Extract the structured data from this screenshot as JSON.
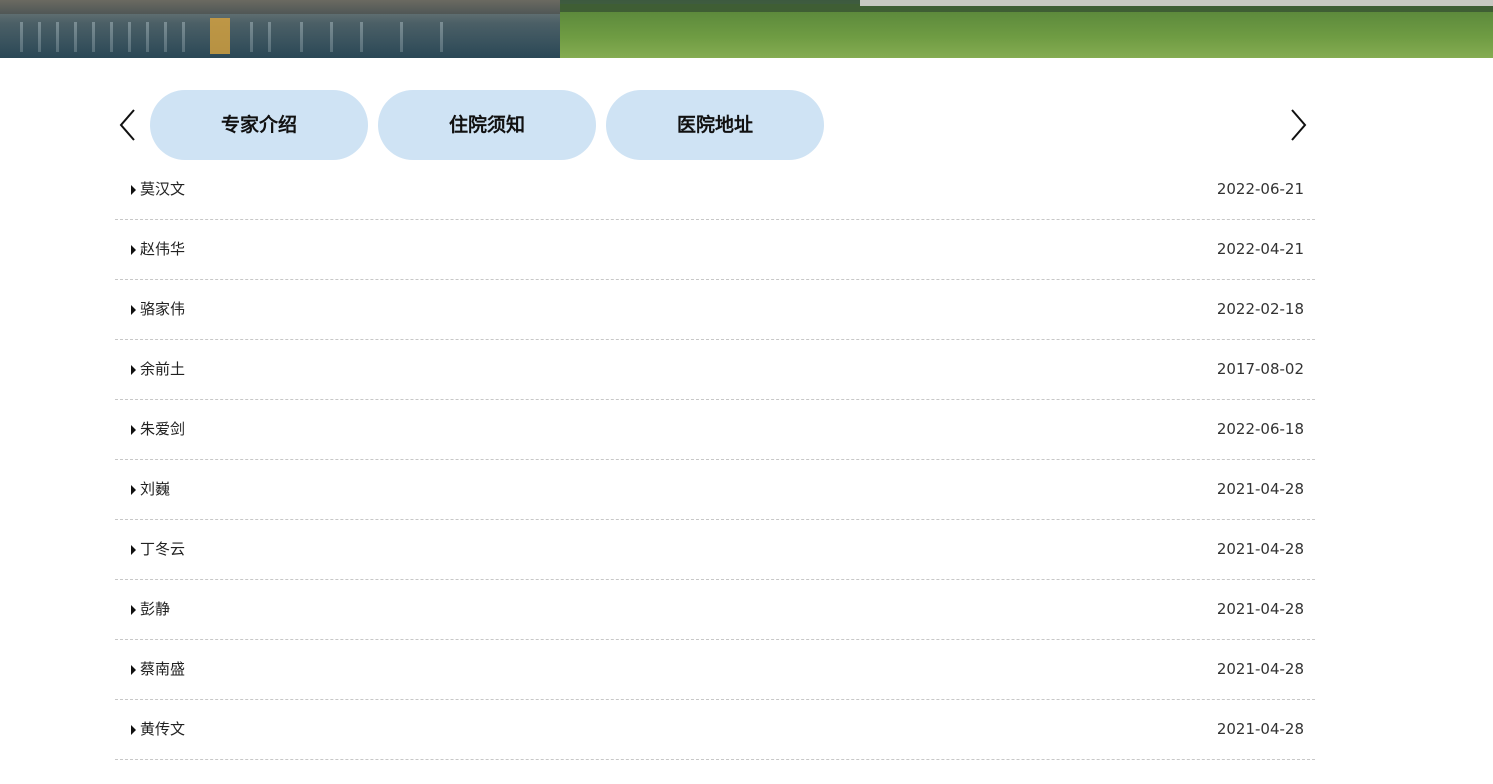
{
  "banner": {
    "alt": "hospital building exterior"
  },
  "tabs": {
    "prev_icon": "chevron-left-icon",
    "next_icon": "chevron-right-icon",
    "items": [
      {
        "label": "专家介绍"
      },
      {
        "label": "住院须知"
      },
      {
        "label": "医院地址"
      }
    ]
  },
  "list": {
    "items": [
      {
        "name": "莫汉文",
        "date": "2022-06-21"
      },
      {
        "name": "赵伟华",
        "date": "2022-04-21"
      },
      {
        "name": "骆家伟",
        "date": "2022-02-18"
      },
      {
        "name": "余前土",
        "date": "2017-08-02"
      },
      {
        "name": "朱爱剑",
        "date": "2022-06-18"
      },
      {
        "name": "刘巍",
        "date": "2021-04-28"
      },
      {
        "name": "丁冬云",
        "date": "2021-04-28"
      },
      {
        "name": "彭静",
        "date": "2021-04-28"
      },
      {
        "name": "蔡南盛",
        "date": "2021-04-28"
      },
      {
        "name": "黄传文",
        "date": "2021-04-28"
      }
    ]
  }
}
